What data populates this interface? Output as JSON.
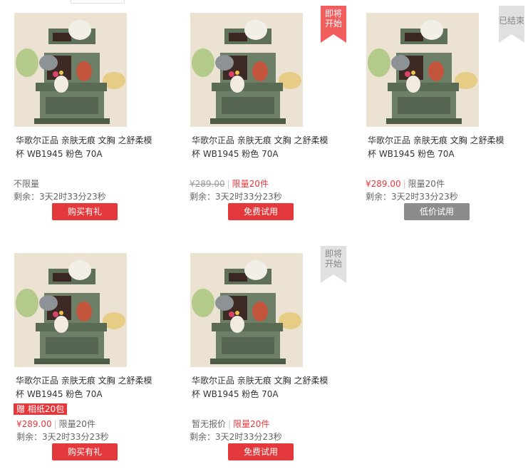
{
  "colors": {
    "accent_red": "#e4393c",
    "ribbon_upcoming": "#f25d5d",
    "ribbon_ended": "#e0e0e0",
    "button_gray": "#8c8c8c"
  },
  "products": [
    {
      "title": "华歌尔正品 亲肤无痕 文胸 之舒柔模杯 WB1945 粉色 70A",
      "image_icon": "product-figurine-photo",
      "price_text": "不限量",
      "remaining": "剩余：3天2时33分23秒",
      "button": "购买有礼"
    },
    {
      "title": "华歌尔正品 亲肤无痕 文胸 之舒柔模杯 WB1945 粉色 70A",
      "image_icon": "product-figurine-photo",
      "ribbon": "即将开始",
      "price": "¥289.00",
      "limit": "限量20件",
      "remaining": "剩余：3天2时33分23秒",
      "button": "免费试用"
    },
    {
      "title": "华歌尔正品 亲肤无痕 文胸 之舒柔模杯 WB1945 粉色 70A",
      "image_icon": "product-figurine-photo",
      "ribbon": "已结束",
      "price": "¥289.00",
      "limit": "限量20件",
      "remaining": "剩余：3天2时33分23秒",
      "button": "低价试用"
    },
    {
      "title": "华歌尔正品 亲肤无痕 文胸 之舒柔模杯 WB1945 粉色 70A",
      "image_icon": "product-figurine-photo",
      "gift_tag": "赠 相纸20包",
      "price": "¥289.00",
      "limit": "限量20件",
      "remaining": "剩余：3天2时33分23秒",
      "button": "购买有礼"
    },
    {
      "title": "华歌尔正品 亲肤无痕 文胸 之舒柔模杯 WB1945 粉色 70A",
      "image_icon": "product-figurine-photo",
      "ribbon": "即将开始",
      "price_text": "暂无报价",
      "limit": "限量20件",
      "remaining": "剩余：3天2时33分23秒",
      "button": "免费试用"
    }
  ]
}
